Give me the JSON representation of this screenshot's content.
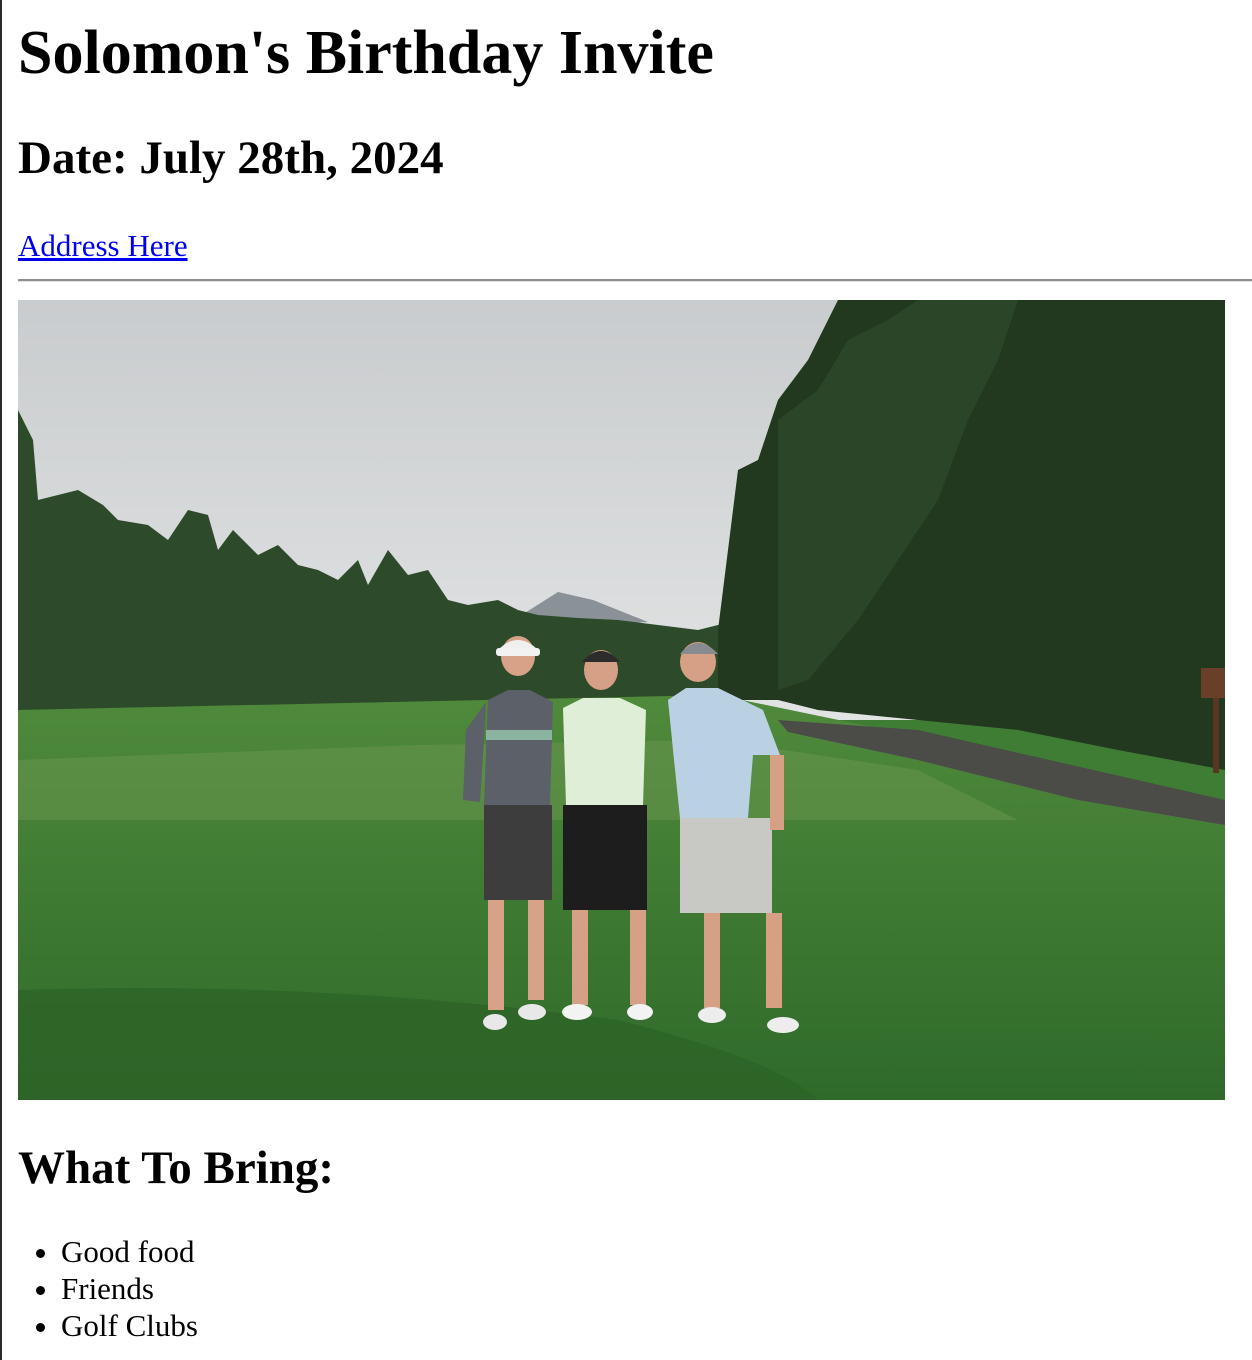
{
  "page": {
    "title": "Solomon's Birthday Invite",
    "date": "Date: July 28th, 2024",
    "address_link": "Address Here",
    "photo_alt": "Three friends on a golf course",
    "bring_heading": "What To Bring:",
    "bring_items": [
      "Good food",
      "Friends",
      "Golf Clubs"
    ]
  },
  "colors": {
    "link": "#0000ee",
    "text": "#000000",
    "divider": "#8f8f8f"
  }
}
